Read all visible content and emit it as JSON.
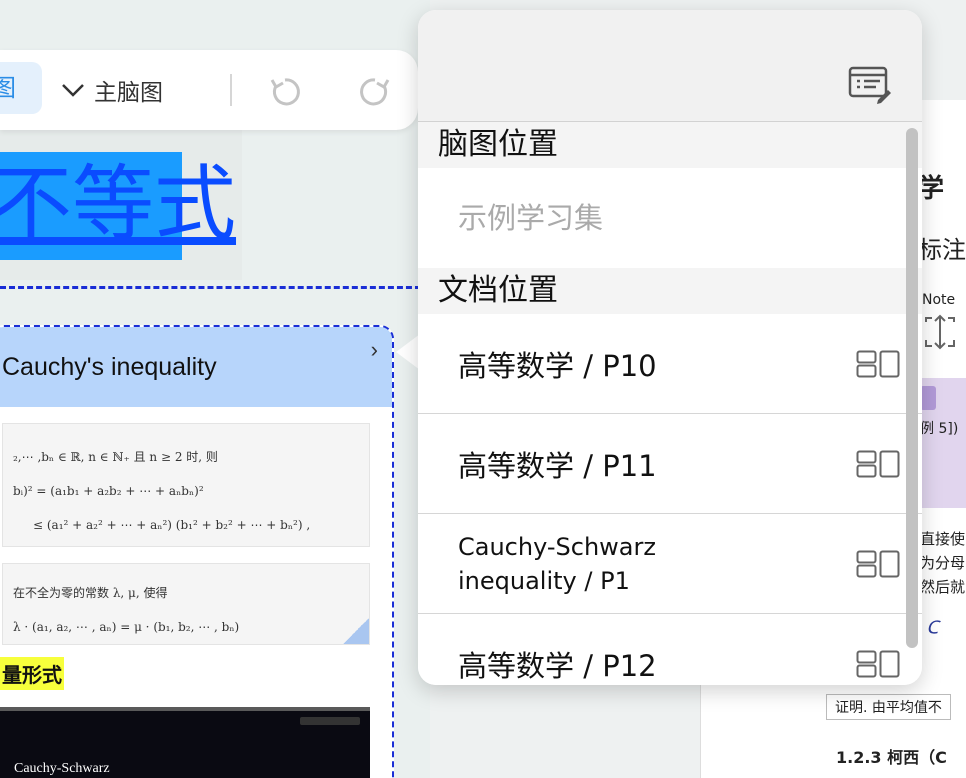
{
  "toolbar": {
    "chip_label": "图",
    "dropdown_label": "主脑图",
    "undo_icon": "undo-icon",
    "redo_icon": "redo-icon"
  },
  "canvas": {
    "title": "不等式",
    "card": {
      "title": "Cauchy's inequality",
      "formula_line1": "₂,⋯ ,bₙ ∈ ℝ, n ∈ ℕ₊ 且 n ≥ 2 时, 则",
      "formula_line2": "bᵢ)² = (a₁b₁ + a₂b₂ + ⋯ + aₙbₙ)²",
      "formula_line3": "≤ (a₁² + a₂² + ⋯ + aₙ²) (b₁² + b₂² + ⋯ + bₙ²) ,",
      "formula_line4": "在不全为零的常数 λ, μ, 使得",
      "formula_line5": "λ · (a₁, a₂, ⋯ , aₙ) = μ · (b₁, b₂, ⋯ , bₙ)",
      "vector_label": "量形式",
      "video_label": "Cauchy-Schwarz"
    }
  },
  "document": {
    "frag_title": "学",
    "frag_annot": "标注",
    "note_label": "Note",
    "frag_ref": "例 5])",
    "frag_line1": "直接使",
    "frag_line2": "为分母",
    "frag_line3": "然后就",
    "frag_proof": "证明. 由平均值不",
    "frag_section": "1.2.3  柯西（C"
  },
  "panel": {
    "edit_icon": "note-edit-icon",
    "mindmap_heading": "脑图位置",
    "mindmap_item": "示例学习集",
    "doc_heading": "文档位置",
    "doc_items": [
      {
        "label": "高等数学 / P10"
      },
      {
        "label": "高等数学 / P11"
      },
      {
        "label": "Cauchy-Schwarz inequality / P1"
      },
      {
        "label": "高等数学 / P12"
      }
    ]
  }
}
